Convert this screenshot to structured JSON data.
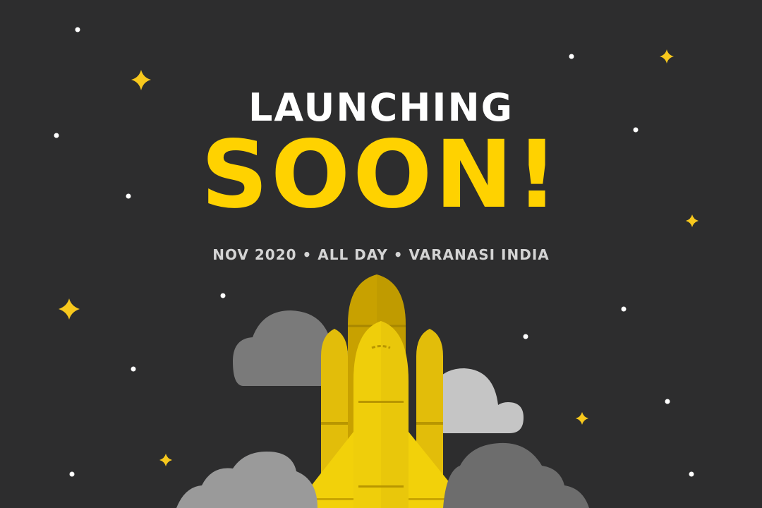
{
  "headline": {
    "top": "LAUNCHING",
    "main": "SOON!"
  },
  "event": {
    "details": "NOV 2020 • ALL DAY • VARANASI INDIA"
  },
  "colors": {
    "background": "#2d2d2e",
    "accent_yellow": "#ffd200",
    "headline_white": "#ffffff",
    "subtitle_gray": "#d4d4d4"
  },
  "icons": {
    "stars": "sparkle-star-icon",
    "dots": "star-dot-icon",
    "rocket": "space-shuttle-icon",
    "clouds": "cloud-icon"
  }
}
